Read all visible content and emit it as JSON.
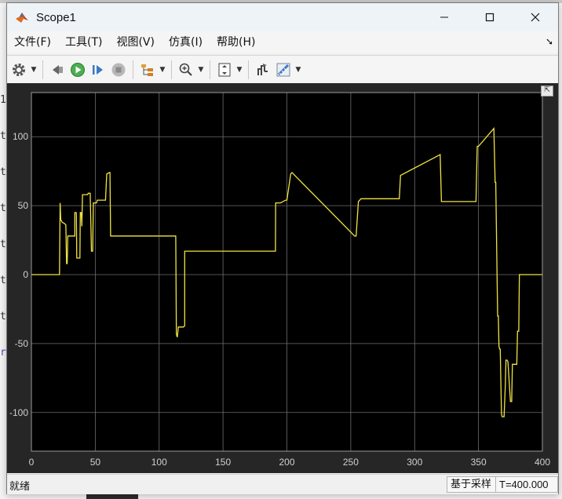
{
  "window": {
    "title": "Scope1"
  },
  "background_app": {
    "line_chars": [
      "1",
      "t",
      "t",
      "t",
      "t",
      "t",
      "t",
      "r"
    ]
  },
  "menu": {
    "items": [
      {
        "label": "文件(F)"
      },
      {
        "label": "工具(T)"
      },
      {
        "label": "视图(V)"
      },
      {
        "label": "仿真(I)"
      },
      {
        "label": "帮助(H)"
      }
    ]
  },
  "toolbar": {
    "buttons": [
      "settings-icon",
      "step-back-icon",
      "run-icon",
      "step-forward-icon",
      "stop-icon",
      "signal-tree-icon",
      "zoom-in-icon",
      "fit-view-icon",
      "write-data-icon",
      "measure-icon"
    ]
  },
  "status": {
    "left": "就绪",
    "sample_mode": "基于采样",
    "time": "T=400.000"
  },
  "colors": {
    "plot_bg": "#262626",
    "axes_bg": "#000000",
    "grid": "#6e6e6e",
    "line": "#f0e442",
    "tick_text": "#d0d0d0"
  },
  "chart_data": {
    "type": "line",
    "title": "",
    "xlabel": "",
    "ylabel": "",
    "xlim": [
      0,
      400
    ],
    "ylim": [
      -128,
      132
    ],
    "xticks": [
      0,
      50,
      100,
      150,
      200,
      250,
      300,
      350,
      400
    ],
    "yticks": [
      -100,
      -50,
      0,
      50,
      100
    ],
    "grid": true,
    "series": [
      {
        "x": [
          0,
          22,
          22.5,
          23,
          24,
          26,
          27,
          27.5,
          28,
          28.5,
          29,
          34,
          34,
          35,
          35.2,
          35.5,
          38,
          38.3,
          39,
          39.5,
          40,
          44,
          44.5,
          46,
          47,
          48,
          48.5,
          51,
          51.5,
          58,
          59,
          61,
          61.5,
          62,
          62.5,
          113,
          113.5,
          114,
          114.3,
          115,
          119,
          120,
          120,
          190,
          191,
          191.2,
          195,
          199,
          200,
          203,
          204,
          204,
          253,
          254,
          254.2,
          256,
          258,
          288,
          289,
          289,
          320,
          321,
          321.5,
          337,
          338,
          338.5,
          348,
          349,
          350,
          362,
          363,
          363.5,
          365,
          365.5,
          366,
          366.5,
          367,
          368,
          368.5,
          370,
          371,
          371.5,
          372,
          372.3,
          373,
          375,
          376,
          376.5,
          377,
          380,
          380.5,
          381,
          381.5,
          382,
          400
        ],
        "y": [
          0,
          0,
          52,
          40,
          38,
          37,
          36,
          8,
          8,
          28,
          28,
          28,
          45,
          45,
          44,
          12,
          12,
          45,
          45,
          35,
          58,
          58,
          59,
          59,
          17,
          17,
          52,
          52,
          54,
          54,
          73,
          74,
          74,
          28,
          28,
          28,
          -43,
          -45,
          -45,
          -38,
          -38,
          -37,
          17,
          17,
          17,
          52,
          52,
          54,
          54,
          73,
          74,
          74,
          28,
          28,
          28,
          53,
          55,
          55,
          72,
          72,
          87,
          53,
          53,
          53,
          53,
          53,
          53,
          93,
          93,
          106,
          67,
          67,
          -30,
          -30,
          -52,
          -54,
          -54,
          -101,
          -103,
          -103,
          -80,
          -62,
          -62,
          -62,
          -63,
          -92,
          -92,
          -65,
          -65,
          -65,
          -41,
          -41,
          -41,
          0,
          0
        ]
      }
    ]
  }
}
